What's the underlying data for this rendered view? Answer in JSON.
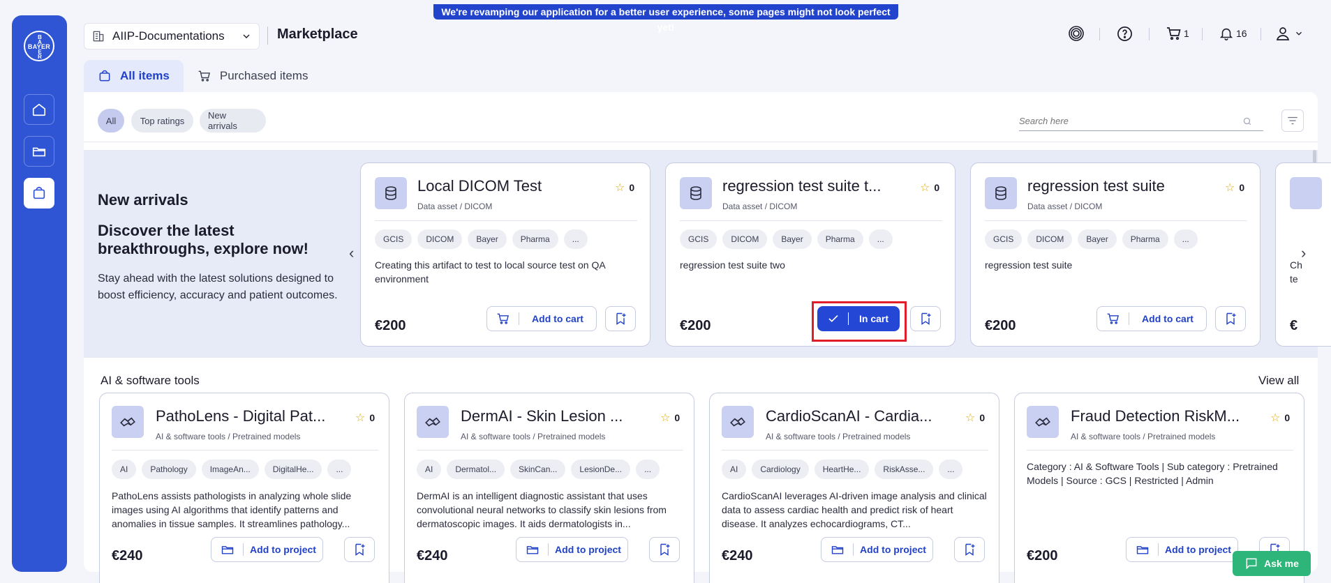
{
  "banner": "We're revamping our application for a better user experience, some pages might not look perfect yet!",
  "sidebar": {
    "logo": {
      "h": "BAYER",
      "v": [
        "B",
        "A",
        "Y",
        "E",
        "R"
      ]
    },
    "items": [
      "home-icon",
      "folder-icon",
      "shopping-bag-icon"
    ]
  },
  "header": {
    "project": "AIIP-Documentations",
    "title": "Marketplace",
    "cart_count": "1",
    "notif_count": "16"
  },
  "tabs": [
    {
      "label": "All items",
      "active": true
    },
    {
      "label": "Purchased items",
      "active": false
    }
  ],
  "filters": [
    "All",
    "Top ratings",
    "New arrivals"
  ],
  "search": {
    "placeholder": "Search here"
  },
  "hero": {
    "heading": "New arrivals",
    "subheading": "Discover the latest breakthroughs, explore now!",
    "text": "Stay ahead with the latest solutions designed to boost efficiency, accuracy and patient outcomes."
  },
  "new_arrivals": [
    {
      "title": "Local DICOM Test",
      "category": "Data asset / DICOM",
      "rating": "0",
      "tags": [
        "GCIS",
        "DICOM",
        "Bayer",
        "Pharma",
        "..."
      ],
      "desc": "Creating this artifact to test to local source test on QA environment",
      "price": "€200",
      "action": "Add to cart",
      "in_cart": false
    },
    {
      "title": "regression test suite t...",
      "category": "Data asset / DICOM",
      "rating": "0",
      "tags": [
        "GCIS",
        "DICOM",
        "Bayer",
        "Pharma",
        "..."
      ],
      "desc": "regression test suite two",
      "price": "€200",
      "action": "In cart",
      "in_cart": true
    },
    {
      "title": "regression test suite",
      "category": "Data asset / DICOM",
      "rating": "0",
      "tags": [
        "GCIS",
        "DICOM",
        "Bayer",
        "Pharma",
        "..."
      ],
      "desc": "regression test suite",
      "price": "€200",
      "action": "Add to cart",
      "in_cart": false
    },
    {
      "title": "",
      "category": "",
      "rating": "",
      "tags": [],
      "desc": "Ch te",
      "price": "€",
      "action": "",
      "in_cart": false
    }
  ],
  "ai_section": {
    "title": "AI & software tools",
    "view_all": "View all",
    "items": [
      {
        "title": "PathoLens - Digital Pat...",
        "category": "AI & software tools / Pretrained models",
        "rating": "0",
        "tags": [
          "AI",
          "Pathology",
          "ImageAn...",
          "DigitalHe...",
          "..."
        ],
        "desc": "PathoLens assists pathologists in analyzing whole slide images using AI algorithms that identify patterns and anomalies in tissue samples. It streamlines pathology...",
        "price": "€240",
        "action": "Add to project"
      },
      {
        "title": "DermAI - Skin Lesion ...",
        "category": "AI & software tools / Pretrained models",
        "rating": "0",
        "tags": [
          "AI",
          "Dermatol...",
          "SkinCan...",
          "LesionDe...",
          "..."
        ],
        "desc": "DermAI is an intelligent diagnostic assistant that uses convolutional neural networks to classify skin lesions from dermatoscopic images. It aids dermatologists in...",
        "price": "€240",
        "action": "Add to project"
      },
      {
        "title": "CardioScanAI - Cardia...",
        "category": "AI & software tools / Pretrained models",
        "rating": "0",
        "tags": [
          "AI",
          "Cardiology",
          "HeartHe...",
          "RiskAsse...",
          "..."
        ],
        "desc": "CardioScanAI leverages AI-driven image analysis and clinical data to assess cardiac health and predict risk of heart disease. It analyzes echocardiograms, CT...",
        "price": "€240",
        "action": "Add to project"
      },
      {
        "title": "Fraud Detection RiskM...",
        "category": "AI & software tools / Pretrained models",
        "rating": "0",
        "tags": [],
        "desc": "Category : AI & Software Tools | Sub category : Pretrained Models | Source : GCS | Restricted | Admin",
        "price": "€200",
        "action": "Add to project"
      }
    ]
  },
  "ask": "Ask me",
  "colors": {
    "primary": "#2447d6",
    "sidebar": "#2f55d4",
    "highlight": "#e11d2a",
    "ask": "#2db57a"
  }
}
